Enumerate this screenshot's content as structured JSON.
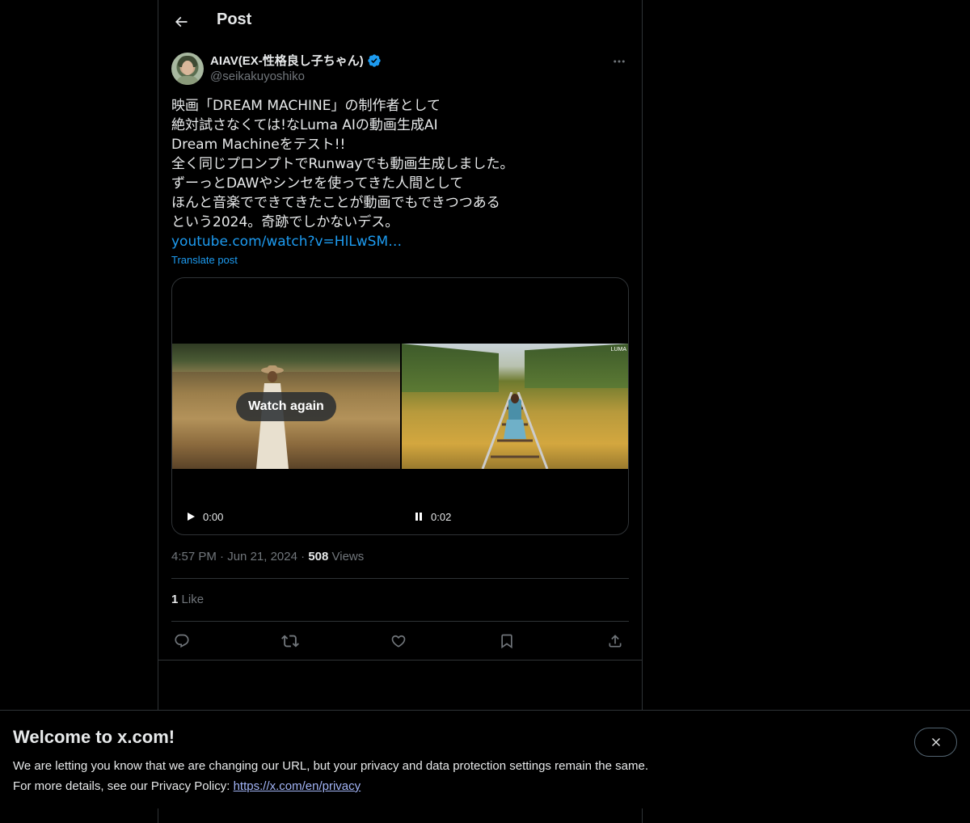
{
  "header": {
    "title": "Post"
  },
  "author": {
    "name": "AIAV(EX-性格良し子ちゃん)",
    "handle": "@seikakuyoshiko"
  },
  "tweet": {
    "lines": [
      "映画「DREAM MACHINE」の制作者として",
      "絶対試さなくては!なLuma AIの動画生成AI",
      "Dream Machineをテスト!!",
      "全く同じプロンプトでRunwayでも動画生成しました。",
      "ずーっとDAWやシンセを使ってきた人間として",
      "ほんと音楽でできてきたことが動画でもできつつある",
      "という2024。奇跡でしかないデス。"
    ],
    "link": "youtube.com/watch?v=HlLwSM…",
    "translate": "Translate post"
  },
  "media": {
    "watch_again": "Watch again",
    "watermark": "LUMA",
    "left_time": "0:00",
    "right_time": "0:02"
  },
  "meta": {
    "time": "4:57 PM",
    "date": "Jun 21, 2024",
    "views_count": "508",
    "views_label": "Views"
  },
  "likes": {
    "count": "1",
    "label": "Like"
  },
  "banner": {
    "title": "Welcome to x.com!",
    "line1": "We are letting you know that we are changing our URL, but your privacy and data protection settings remain the same.",
    "line2_prefix": "For more details, see our Privacy Policy: ",
    "link": "https://x.com/en/privacy"
  },
  "colors": {
    "accent": "#1d9bf0",
    "background": "#000000",
    "border": "#2f3336",
    "muted": "#71767b"
  }
}
